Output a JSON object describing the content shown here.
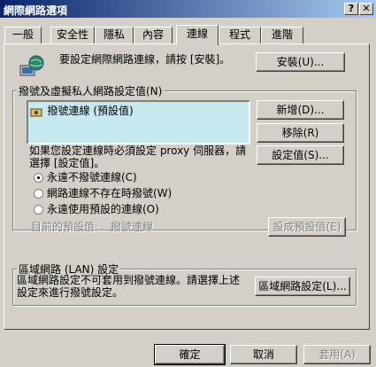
{
  "window": {
    "title": "網際網路選項",
    "help_button": "?",
    "close_button": "✕"
  },
  "tabs": [
    {
      "label": "一般"
    },
    {
      "label": "安全性"
    },
    {
      "label": "隱私"
    },
    {
      "label": "內容"
    },
    {
      "label": "連線",
      "active": true
    },
    {
      "label": "程式"
    },
    {
      "label": "進階"
    }
  ],
  "setup": {
    "text": "要設定網際網路連線，請按 [安裝]。",
    "button": "安裝(U)..."
  },
  "dialup": {
    "legend": "撥號及虛擬私人網路設定值(N)",
    "list": [
      {
        "label": "撥號連線 (預設值)"
      }
    ],
    "add_button": "新增(D)...",
    "remove_button": "移除(R)",
    "settings_button": "設定值(S)...",
    "proxy_note": "如果您設定連線時必須設定 proxy 伺服器，請選擇 [設定值]。",
    "options": [
      {
        "label": "永遠不撥號連線(C)",
        "checked": true
      },
      {
        "label": "網路連線不存在時撥號(W)",
        "checked": false
      },
      {
        "label": "永遠使用預設的連線(O)",
        "checked": false
      }
    ],
    "current_default_label": "目前的預設值:",
    "current_default_value": "撥號連線",
    "set_default_button": "設成預設值(E)"
  },
  "lan": {
    "legend": "區域網路 (LAN) 設定",
    "note": "區域網路設定不可套用到撥號連線。請選擇上述設定來進行撥號設定。",
    "button": "區域網路設定(L)..."
  },
  "footer": {
    "ok": "確定",
    "cancel": "取消",
    "apply": "套用(A)"
  },
  "colors": {
    "title_gradient_start": "#0a246a",
    "title_gradient_end": "#a6caf0",
    "listbox_bg": "#c8e8f0",
    "window_bg": "#d4d0c8"
  }
}
